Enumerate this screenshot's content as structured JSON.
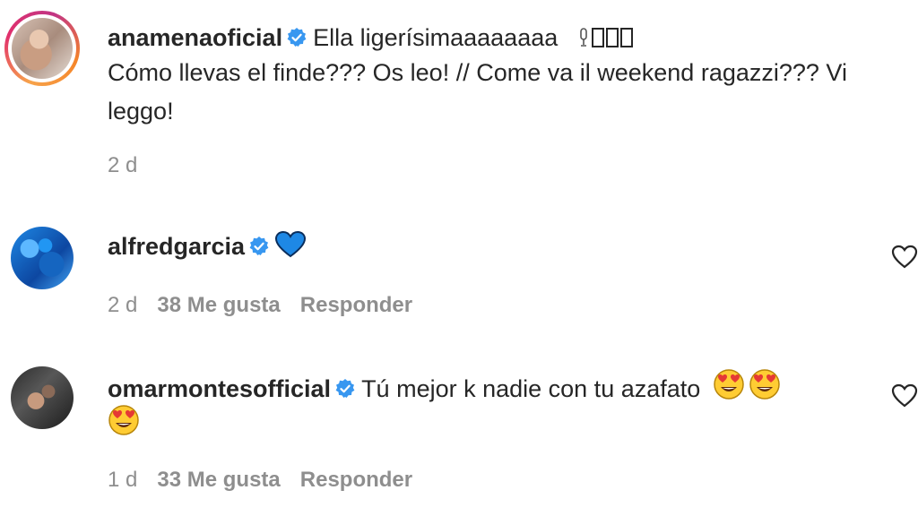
{
  "comments": [
    {
      "username": "anamenaoficial",
      "verified": true,
      "text_line1": "Ella ligerísimaaaaaaaa",
      "text_line2": "Cómo llevas el finde??? Os leo! // Come va il weekend ragazzi??? Vi",
      "text_line3": "leggo!",
      "time": "2 d",
      "is_caption": true
    },
    {
      "username": "alfredgarcia",
      "verified": true,
      "text_line1": "",
      "emoji": "blue-heart",
      "time": "2 d",
      "likes": "38 Me gusta",
      "reply": "Responder"
    },
    {
      "username": "omarmontesofficial",
      "verified": true,
      "text_line1": "Tú mejor k nadie con tu azafato",
      "emoji": "heart-eyes",
      "time": "1 d",
      "likes": "33 Me gusta",
      "reply": "Responder"
    }
  ],
  "colors": {
    "verified_blue": "#3897f0",
    "meta_gray": "#8e8e8e",
    "text": "#262626"
  }
}
